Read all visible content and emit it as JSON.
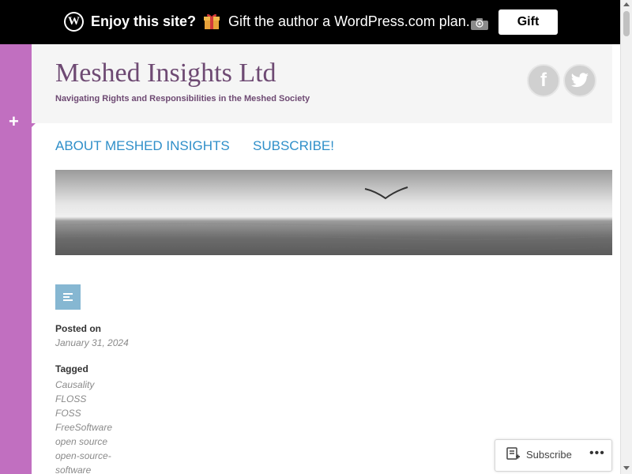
{
  "promo": {
    "headline": "Enjoy this site?",
    "gift_icon": "gift-icon",
    "message": "Gift the author a WordPress.com plan.",
    "button_label": "Gift",
    "logo_glyph": "W"
  },
  "sidebar": {
    "toggle_label": "+"
  },
  "header": {
    "title": "Meshed Insights Ltd",
    "tagline": "Navigating Rights and Responsibilities in the Meshed Society",
    "social": [
      {
        "name": "facebook",
        "glyph": "f"
      },
      {
        "name": "twitter",
        "glyph": "twitter-bird"
      }
    ]
  },
  "nav": {
    "items": [
      "ABOUT MESHED INSIGHTS",
      "SUBSCRIBE!"
    ]
  },
  "post": {
    "format_icon": "standard-post-icon",
    "posted_label": "Posted on",
    "posted_date": "January 31, 2024",
    "tagged_label": "Tagged",
    "tags": [
      "Causality",
      "FLOSS",
      "FOSS",
      "FreeSoftware",
      "open source",
      "open-source-",
      "software"
    ]
  },
  "subscribe_widget": {
    "label": "Subscribe",
    "more_glyph": "•••"
  },
  "colors": {
    "accent_purple": "#c16fc0",
    "title_color": "#6e4a73",
    "link_blue": "#2f8fc9",
    "format_icon_bg": "#86b7d2"
  }
}
